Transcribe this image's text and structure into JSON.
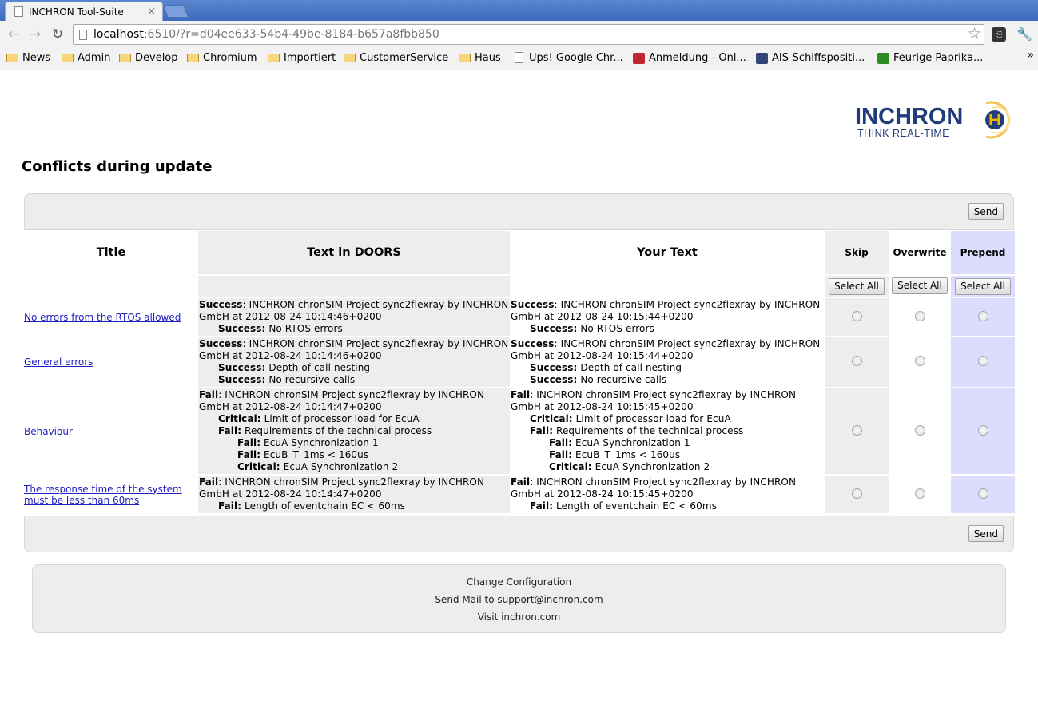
{
  "browser": {
    "tab_title": "INCHRON Tool-Suite",
    "tab_close": "×",
    "url_host": "localhost",
    "url_rest": ":6510/?r=d04ee633-54b4-49be-8184-b657a8fbb850",
    "bookmarks": [
      {
        "label": "News",
        "icon": "folder-icon"
      },
      {
        "label": "Admin",
        "icon": "folder-icon"
      },
      {
        "label": "Develop",
        "icon": "folder-icon"
      },
      {
        "label": "Chromium",
        "icon": "folder-icon"
      },
      {
        "label": "Importiert",
        "icon": "folder-icon"
      },
      {
        "label": "CustomerService",
        "icon": "folder-icon"
      },
      {
        "label": "Haus",
        "icon": "folder-icon"
      },
      {
        "label": "Ups! Google Chr...",
        "icon": "page-icon"
      },
      {
        "label": "Anmeldung - Onl...",
        "icon": "fan-icon"
      },
      {
        "label": "AIS-Schiffspositi...",
        "icon": "ship-icon"
      },
      {
        "label": "Feurige Paprika...",
        "icon": "recipe-icon"
      }
    ],
    "more": "»"
  },
  "logo": {
    "brand": "INCHRON",
    "tagline": "THINK REAL-TIME"
  },
  "page": {
    "title": "Conflicts during update",
    "send_label": "Send",
    "select_all_label": "Select All"
  },
  "table": {
    "headers": {
      "title": "Title",
      "doors": "Text in DOORS",
      "yours": "Your Text",
      "skip": "Skip",
      "overwrite": "Overwrite",
      "prepend": "Prepend"
    },
    "rows": [
      {
        "title": "No errors from the RTOS allowed",
        "doors": [
          {
            "level": 0,
            "status": "Success",
            "sep": ": ",
            "text": "INCHRON chronSIM Project sync2flexray by INCHRON GmbH at 2012-08-24 10:14:46+0200"
          },
          {
            "level": 1,
            "status": "Success:",
            "sep": " ",
            "text": "No RTOS errors"
          }
        ],
        "yours": [
          {
            "level": 0,
            "status": "Success",
            "sep": ": ",
            "text": "INCHRON chronSIM Project sync2flexray by INCHRON GmbH at 2012-08-24 10:15:44+0200"
          },
          {
            "level": 1,
            "status": "Success:",
            "sep": " ",
            "text": "No RTOS errors"
          }
        ]
      },
      {
        "title": "General errors",
        "doors": [
          {
            "level": 0,
            "status": "Success",
            "sep": ": ",
            "text": "INCHRON chronSIM Project sync2flexray by INCHRON GmbH at 2012-08-24 10:14:46+0200"
          },
          {
            "level": 1,
            "status": "Success:",
            "sep": " ",
            "text": "Depth of call nesting"
          },
          {
            "level": 1,
            "status": "Success:",
            "sep": " ",
            "text": "No recursive calls"
          }
        ],
        "yours": [
          {
            "level": 0,
            "status": "Success",
            "sep": ": ",
            "text": "INCHRON chronSIM Project sync2flexray by INCHRON GmbH at 2012-08-24 10:15:44+0200"
          },
          {
            "level": 1,
            "status": "Success:",
            "sep": " ",
            "text": "Depth of call nesting"
          },
          {
            "level": 1,
            "status": "Success:",
            "sep": " ",
            "text": "No recursive calls"
          }
        ]
      },
      {
        "title": "Behaviour",
        "doors": [
          {
            "level": 0,
            "status": "Fail",
            "sep": ": ",
            "text": "INCHRON chronSIM Project sync2flexray by INCHRON GmbH at 2012-08-24 10:14:47+0200"
          },
          {
            "level": 1,
            "status": "Critical:",
            "sep": " ",
            "text": "Limit of processor load for EcuA"
          },
          {
            "level": 1,
            "status": "Fail:",
            "sep": " ",
            "text": "Requirements of the technical process"
          },
          {
            "level": 2,
            "status": "Fail:",
            "sep": " ",
            "text": "EcuA Synchronization 1"
          },
          {
            "level": 2,
            "status": "Fail:",
            "sep": " ",
            "text": "EcuB_T_1ms < 160us"
          },
          {
            "level": 2,
            "status": "Critical:",
            "sep": " ",
            "text": "EcuA Synchronization 2"
          }
        ],
        "yours": [
          {
            "level": 0,
            "status": "Fail",
            "sep": ": ",
            "text": "INCHRON chronSIM Project sync2flexray by INCHRON GmbH at 2012-08-24 10:15:45+0200"
          },
          {
            "level": 1,
            "status": "Critical:",
            "sep": " ",
            "text": "Limit of processor load for EcuA"
          },
          {
            "level": 1,
            "status": "Fail:",
            "sep": " ",
            "text": "Requirements of the technical process"
          },
          {
            "level": 2,
            "status": "Fail:",
            "sep": " ",
            "text": "EcuA Synchronization 1"
          },
          {
            "level": 2,
            "status": "Fail:",
            "sep": " ",
            "text": "EcuB_T_1ms < 160us"
          },
          {
            "level": 2,
            "status": "Critical:",
            "sep": " ",
            "text": "EcuA Synchronization 2"
          }
        ]
      },
      {
        "title": "The response time of the system must be less than 60ms",
        "doors": [
          {
            "level": 0,
            "status": "Fail",
            "sep": ": ",
            "text": "INCHRON chronSIM Project sync2flexray by INCHRON GmbH at 2012-08-24 10:14:47+0200"
          },
          {
            "level": 1,
            "status": "Fail:",
            "sep": " ",
            "text": "Length of eventchain EC < 60ms"
          }
        ],
        "yours": [
          {
            "level": 0,
            "status": "Fail",
            "sep": ": ",
            "text": "INCHRON chronSIM Project sync2flexray by INCHRON GmbH at 2012-08-24 10:15:45+0200"
          },
          {
            "level": 1,
            "status": "Fail:",
            "sep": " ",
            "text": "Length of eventchain EC < 60ms"
          }
        ]
      }
    ]
  },
  "footer": {
    "change_config": "Change Configuration",
    "send_mail": "Send Mail to support@inchron.com",
    "visit": "Visit inchron.com"
  },
  "colors": {
    "grey": "#ededed",
    "prepend_blue": "#dcdcff",
    "link": "#2020c0",
    "brand": "#1f3d7a",
    "brand_accent": "#f5b400"
  }
}
